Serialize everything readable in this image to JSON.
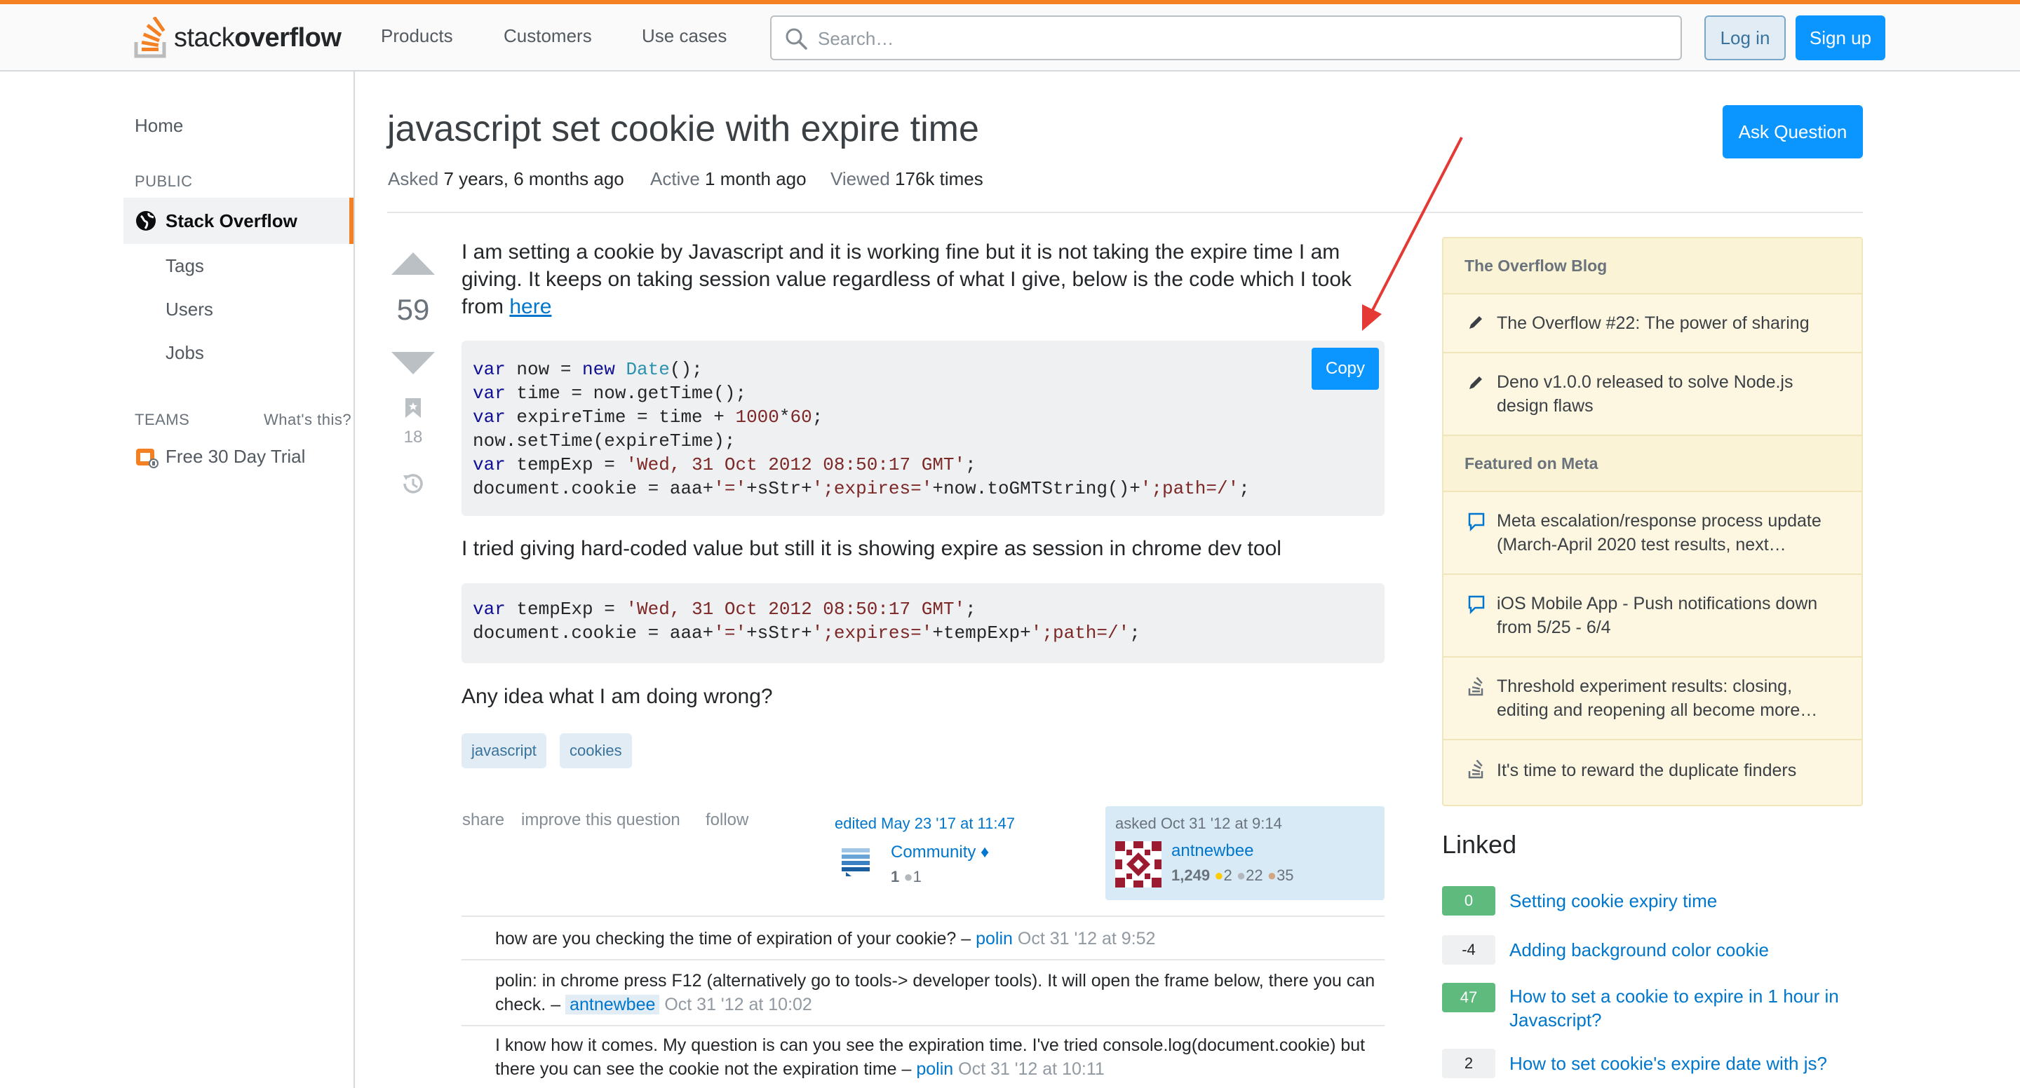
{
  "header": {
    "logo_text_light": "stack",
    "logo_text_bold": "overflow",
    "nav": [
      "Products",
      "Customers",
      "Use cases"
    ],
    "search_placeholder": "Search…",
    "login_label": "Log in",
    "signup_label": "Sign up"
  },
  "sidebar": {
    "home": "Home",
    "public_heading": "PUBLIC",
    "stack_overflow": "Stack Overflow",
    "tags": "Tags",
    "users": "Users",
    "jobs": "Jobs",
    "teams_heading": "TEAMS",
    "whats_this": "What's this?",
    "free_trial": "Free 30 Day Trial"
  },
  "question": {
    "title": "javascript set cookie with expire time",
    "ask_button": "Ask Question",
    "meta": [
      {
        "key": "Asked",
        "value": "7 years, 6 months ago"
      },
      {
        "key": "Active",
        "value": "1 month ago"
      },
      {
        "key": "Viewed",
        "value": "176k times"
      }
    ],
    "votes": "59",
    "bookmarks": "18",
    "body_intro": "I am setting a cookie by Javascript and it is working fine but it is not taking the expire time I am giving. It keeps on taking session value regardless of what I give, below is the code which I took from ",
    "body_intro_link": "here",
    "copy_button": "Copy",
    "body_mid": "I tried giving hard-coded value but still it is showing expire as session in chrome dev tool",
    "body_end": "Any idea what I am doing wrong?",
    "tags": [
      "javascript",
      "cookies"
    ],
    "actions": [
      "share",
      "improve this question",
      "follow"
    ],
    "edited": {
      "label": "edited May 23 '17 at 11:47",
      "user": "Community",
      "diamond": "♦",
      "rep": "1",
      "badge_bronze": "1"
    },
    "asked": {
      "label": "asked Oct 31 '12 at 9:14",
      "user": "antnewbee",
      "rep": "1,249",
      "gold": "2",
      "silver": "22",
      "bronze": "35"
    }
  },
  "comments": [
    {
      "text": "how are you checking the time of expiration of your cookie? – ",
      "user": "polin",
      "date": "Oct 31 '12 at 9:52"
    },
    {
      "text": "polin: in chrome press F12 (alternatively go to tools-> developer tools). It will open the frame below, there you can check. – ",
      "user": "antnewbee",
      "date": "Oct 31 '12 at 10:02"
    },
    {
      "text": "I know how it comes. My question is can you see the expiration time. I've tried console.log(document.cookie) but there you can see the cookie not the expiration time – ",
      "user": "polin",
      "date": "Oct 31 '12 at 10:11"
    }
  ],
  "blog": {
    "heading": "The Overflow Blog",
    "items": [
      {
        "icon": "pencil-icon",
        "text": "The Overflow #22: The power of sharing"
      },
      {
        "icon": "pencil-icon",
        "text": "Deno v1.0.0 released to solve Node.js design flaws"
      }
    ],
    "meta_heading": "Featured on Meta",
    "meta_items": [
      {
        "icon": "speech-bubble-icon",
        "text": "Meta escalation/response process update (March-April 2020 test results, next…"
      },
      {
        "icon": "speech-bubble-icon",
        "text": "iOS Mobile App - Push notifications down from 5/25 - 6/4"
      },
      {
        "icon": "stack-icon",
        "text": "Threshold experiment results: closing, editing and reopening all become more…"
      },
      {
        "icon": "stack-icon",
        "text": "It's time to reward the duplicate finders"
      }
    ]
  },
  "linked": {
    "heading": "Linked",
    "items": [
      {
        "score": "0",
        "answered": true,
        "text": "Setting cookie expiry time"
      },
      {
        "score": "-4",
        "answered": false,
        "text": "Adding background color cookie"
      },
      {
        "score": "47",
        "answered": true,
        "text": "How to set a cookie to expire in 1 hour in Javascript?"
      },
      {
        "score": "2",
        "answered": false,
        "text": "How to set cookie's expire date with js?"
      }
    ]
  },
  "colors": {
    "accent_orange": "#f48024",
    "primary_blue": "#0a95ff",
    "link_blue": "#0077cc",
    "annotation_red": "#e53935"
  }
}
